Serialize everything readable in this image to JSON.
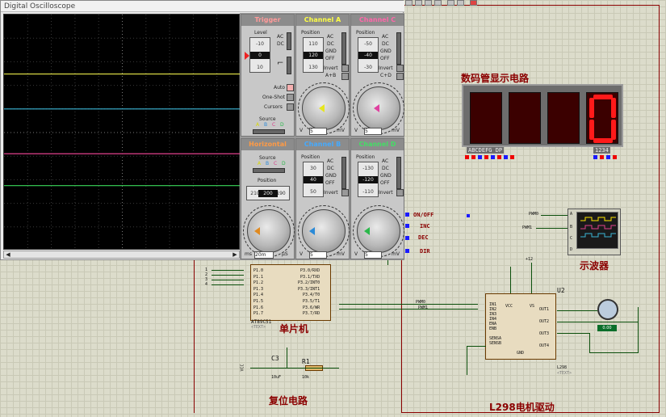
{
  "window": {
    "title": "Digital Oscilloscope"
  },
  "scope": {
    "traces": [
      {
        "name": "A",
        "color": "#e8e84a",
        "level": 0.252
      },
      {
        "name": "B",
        "color": "#3ab6d6",
        "level": 0.4
      },
      {
        "name": "C",
        "color": "#e0408c",
        "level": 0.59
      },
      {
        "name": "D",
        "color": "#3ad65a",
        "level": 0.725
      }
    ],
    "trigger": {
      "title": "Trigger",
      "level_label": "Level",
      "level_values": [
        "-10",
        "0",
        "10"
      ],
      "ac": "AC",
      "dc": "DC",
      "auto": "Auto",
      "one_shot": "One-Shot",
      "cursors": "Cursors",
      "source_label": "Source",
      "source_letters": [
        "A",
        "B",
        "C",
        "D"
      ]
    },
    "channel_a": {
      "title": "Channel A",
      "position_label": "Position",
      "values": [
        "110",
        "120",
        "130"
      ],
      "options": [
        "AC",
        "DC",
        "GND",
        "OFF",
        "Invert",
        "A+B"
      ],
      "units": [
        "V",
        "5",
        "mV"
      ]
    },
    "channel_c": {
      "title": "Channel C",
      "position_label": "Position",
      "values": [
        "-50",
        "-40",
        "-30"
      ],
      "options": [
        "AC",
        "DC",
        "GND",
        "OFF",
        "Invert",
        "C+D"
      ],
      "units": [
        "V",
        "5",
        "mV"
      ]
    },
    "horizontal": {
      "title": "Horizontal",
      "source_label": "Source",
      "source_letters": [
        "A",
        "B",
        "C",
        "D"
      ],
      "position_label": "Position",
      "values": [
        "210",
        "200",
        "190"
      ],
      "units": [
        "ms",
        "20m",
        "µS"
      ]
    },
    "channel_b": {
      "title": "Channel B",
      "position_label": "Position",
      "values": [
        "30",
        "40",
        "50"
      ],
      "options": [
        "AC",
        "DC",
        "GND",
        "OFF",
        "Invert"
      ],
      "units": [
        "V",
        "5",
        "mV"
      ]
    },
    "channel_d": {
      "title": "Channel D",
      "position_label": "Position",
      "values": [
        "-130",
        "-120",
        "-110"
      ],
      "options": [
        "AC",
        "DC",
        "GND",
        "OFF",
        "Invert"
      ],
      "units": [
        "V",
        "5",
        "mV"
      ]
    }
  },
  "schematic": {
    "seg_title": "数码管显示电路",
    "seg_pins": "ABCDEFG  DP",
    "seg_digits_label": "1234",
    "digits_on": [
      null,
      null,
      null,
      "0"
    ],
    "controls": [
      "ON/OFF",
      "INC",
      "DEC",
      "DIR"
    ],
    "scope_title": "示波器",
    "scope_inputs": [
      "PWM0",
      "PWM1"
    ],
    "scope_channels": [
      "A",
      "B",
      "C",
      "D"
    ],
    "mcu_title": "单片机",
    "mcu_part": "AT89C51",
    "mcu_text": "<TEXT>",
    "mcu_left_pins": [
      "P1.0",
      "P1.1",
      "P1.2",
      "P1.3",
      "P1.4",
      "P1.5",
      "P1.6",
      "P1.7"
    ],
    "mcu_right_pins": [
      "P3.0/RXD",
      "P3.1/TXD",
      "P3.2/INT0",
      "P3.3/INT1",
      "P3.4/T0",
      "P3.5/T1",
      "P3.6/WR",
      "P3.7/RD"
    ],
    "mcu_left_nums": [
      "1",
      "2",
      "3",
      "4"
    ],
    "pwm_labels": [
      "PWM0",
      "PWM1"
    ],
    "driver_title": "L298电机驱动",
    "driver_ref": "U2",
    "driver_part": "L298",
    "driver_text": "<TEXT>",
    "driver_left_pins": [
      "IN1",
      "IN2",
      "IN3",
      "IN4",
      "ENA",
      "ENB",
      "SENSA",
      "SENSB"
    ],
    "driver_right_pins": [
      "OUT1",
      "OUT2",
      "OUT3",
      "OUT4"
    ],
    "driver_vcc": "VCC",
    "driver_vs": "VS",
    "driver_gnd": "GND",
    "supply": "+12",
    "reset_title": "复位电路",
    "c3": "C3",
    "c3_val": "10uF",
    "r1": "R1",
    "r1_val": "10k",
    "vcc_label": "VCC",
    "motor_badge": "0.00"
  }
}
